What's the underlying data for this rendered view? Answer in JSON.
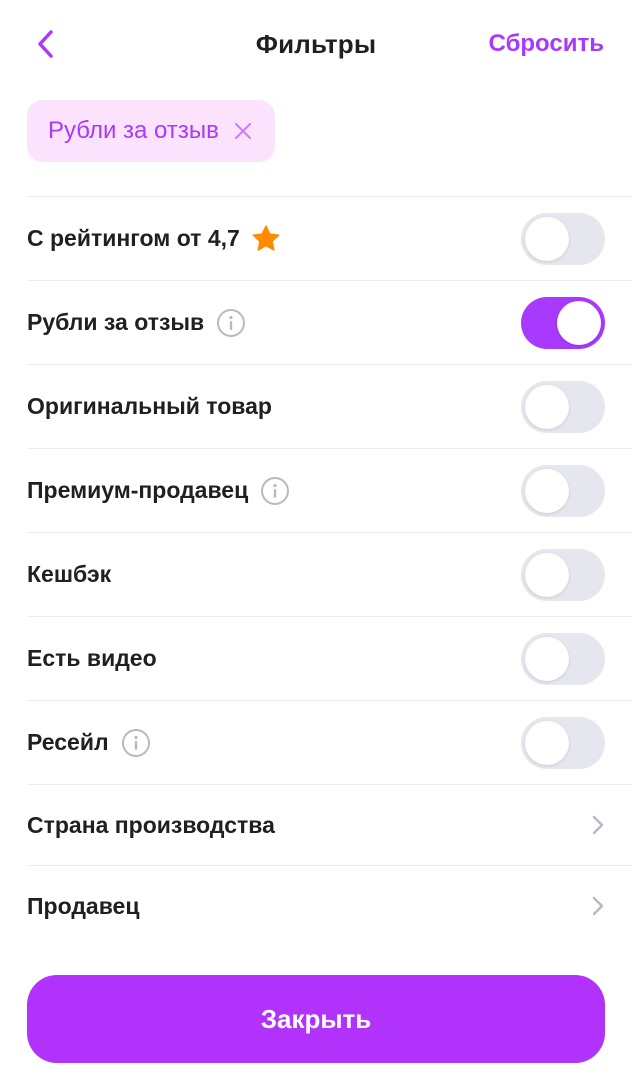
{
  "header": {
    "title": "Фильтры",
    "reset_label": "Сбросить"
  },
  "active_chip": {
    "label": "Рубли за отзыв"
  },
  "toggles": [
    {
      "label": "С рейтингом от 4,7",
      "icon": "star-icon",
      "on": false
    },
    {
      "label": "Рубли за отзыв",
      "icon": "info-icon",
      "on": true
    },
    {
      "label": "Оригинальный товар",
      "icon": null,
      "on": false
    },
    {
      "label": "Премиум-продавец",
      "icon": "info-icon",
      "on": false
    },
    {
      "label": "Кешбэк",
      "icon": null,
      "on": false
    },
    {
      "label": "Есть видео",
      "icon": null,
      "on": false
    },
    {
      "label": "Ресейл",
      "icon": "info-icon",
      "on": false
    }
  ],
  "nav_items": [
    {
      "label": "Страна производства"
    },
    {
      "label": "Продавец"
    }
  ],
  "footer": {
    "close_label": "Закрыть"
  },
  "colors": {
    "accent": "#a73afd",
    "button": "#b032fb",
    "chip_bg": "#fbe2fd",
    "star": "#ff8a00",
    "toggle_off": "#e6e6ef"
  }
}
